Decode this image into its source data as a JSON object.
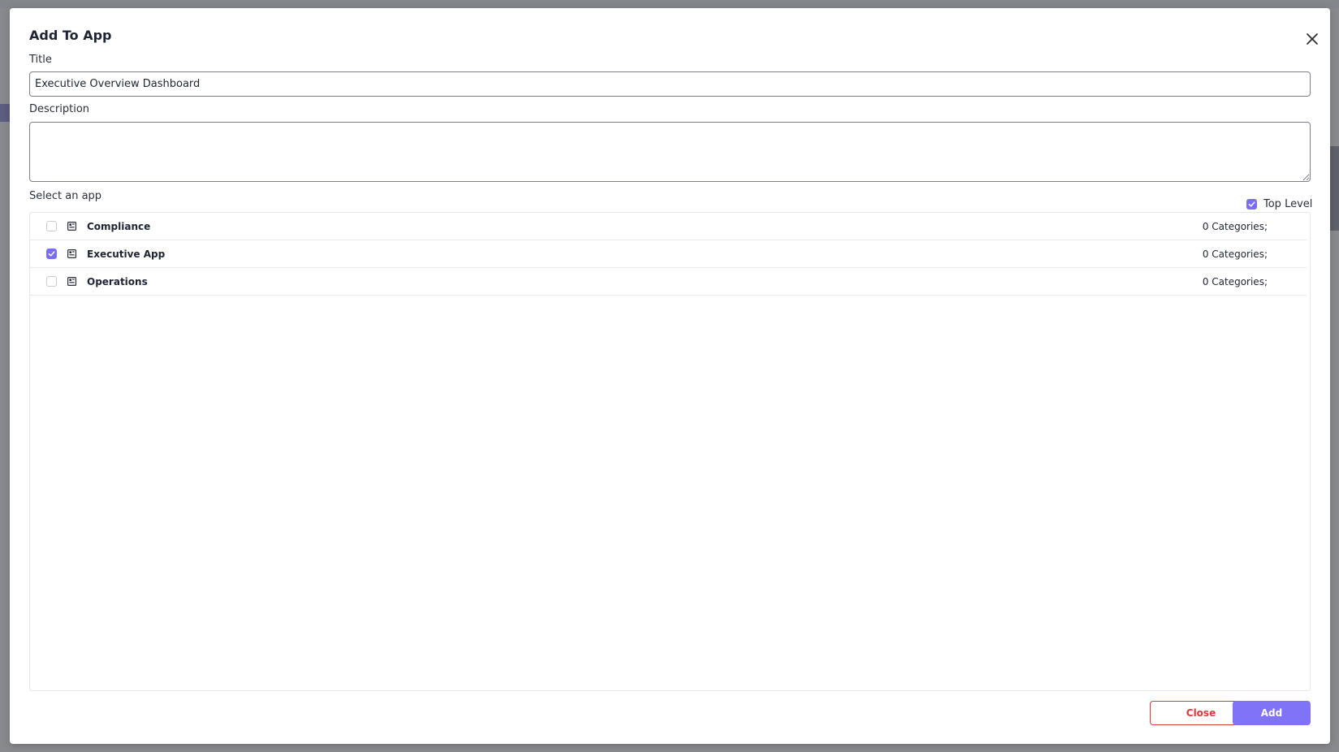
{
  "dialog": {
    "title": "Add To App",
    "title_label": "Title",
    "title_value": "Executive Overview Dashboard",
    "description_label": "Description",
    "description_value": "",
    "select_label": "Select an app",
    "top_level_label": "Top Level",
    "top_level_checked": true
  },
  "apps": [
    {
      "name": "Compliance",
      "categories": "0 Categories;",
      "checked": false
    },
    {
      "name": "Executive App",
      "categories": "0 Categories;",
      "checked": true
    },
    {
      "name": "Operations",
      "categories": "0 Categories;",
      "checked": false
    }
  ],
  "buttons": {
    "close_label": "Close",
    "add_label": "Add"
  },
  "colors": {
    "accent": "#7b6ef6",
    "danger": "#d63b3b",
    "text": "#1e2432"
  },
  "icons": {
    "close": "close-icon",
    "app": "app-grid-icon",
    "check": "check-icon"
  }
}
